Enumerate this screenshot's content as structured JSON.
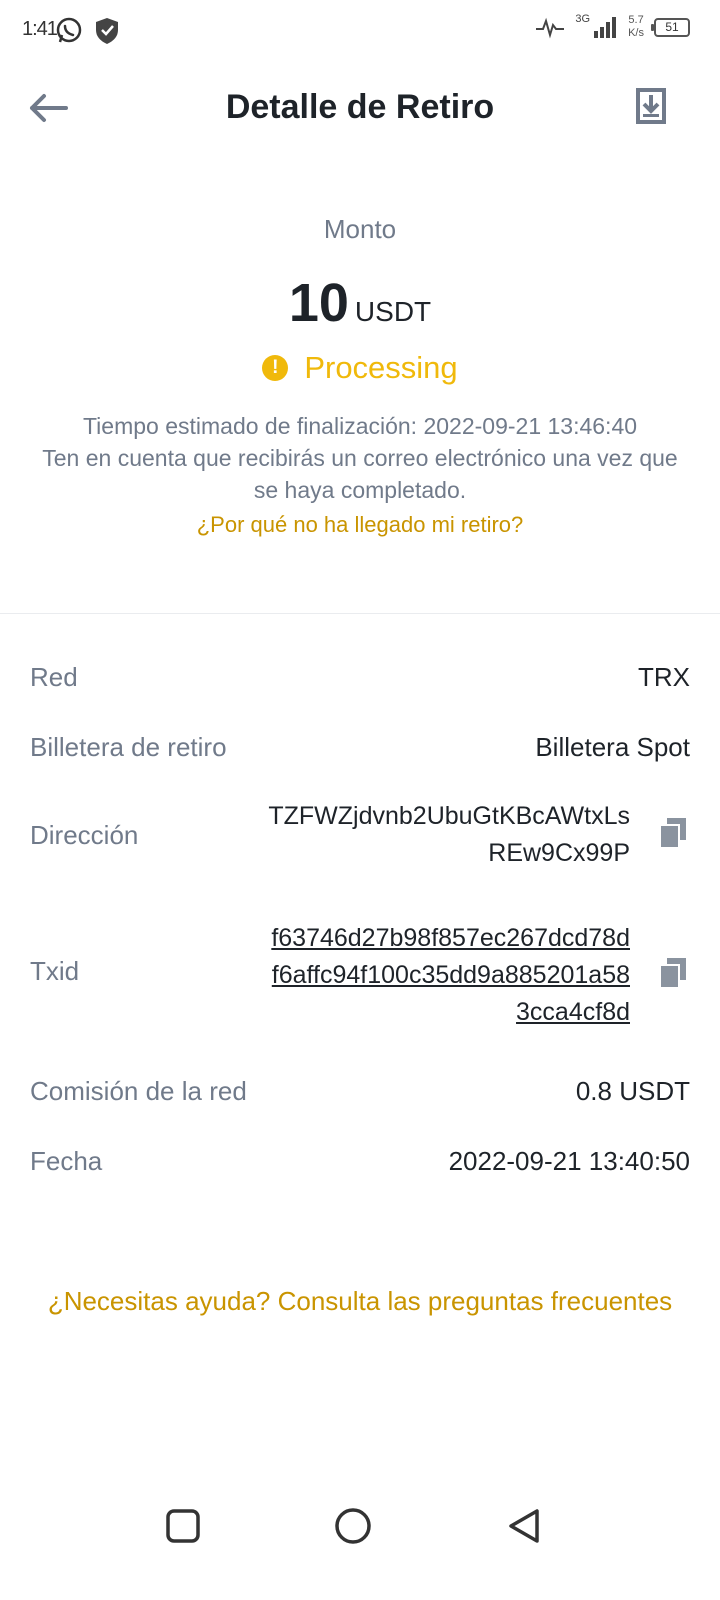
{
  "status_bar": {
    "time": "1:41",
    "net_type": "3G",
    "net_speed_value": "5.7",
    "net_speed_unit": "K/s",
    "battery": "51"
  },
  "header": {
    "title": "Detalle de Retiro"
  },
  "summary": {
    "amount_label": "Monto",
    "amount_value": "10",
    "amount_unit": "USDT",
    "status": "Processing",
    "estimated_time": "Tiempo estimado de finalización: 2022-09-21 13:46:40",
    "email_notice": "Ten en cuenta que recibirás un correo electrónico una vez que se haya completado.",
    "why_link": "¿Por qué no ha llegado mi retiro?"
  },
  "details": {
    "network_label": "Red",
    "network_value": "TRX",
    "wallet_label": "Billetera de retiro",
    "wallet_value": "Billetera Spot",
    "address_label": "Dirección",
    "address_line1": "TZFWZjdvnb2UbuGtKBcAWtxLs",
    "address_line2": "REw9Cx99P",
    "txid_label": "Txid",
    "txid_line1": "f63746d27b98f857ec267dcd78d",
    "txid_line2": "f6affc94f100c35dd9a885201a58",
    "txid_line3": "3cca4cf8d",
    "fee_label": "Comisión de la red",
    "fee_value": "0.8 USDT",
    "date_label": "Fecha",
    "date_value": "2022-09-21 13:40:50"
  },
  "help_link": "¿Necesitas ayuda? Consulta las preguntas frecuentes",
  "colors": {
    "accent": "#f0b90b",
    "link": "#c99400",
    "text_primary": "#1e2329",
    "text_secondary": "#707a8a"
  },
  "icons": {
    "back": "arrow-left-icon",
    "download": "download-icon",
    "copy": "copy-icon",
    "status": "exclamation-circle-icon"
  }
}
